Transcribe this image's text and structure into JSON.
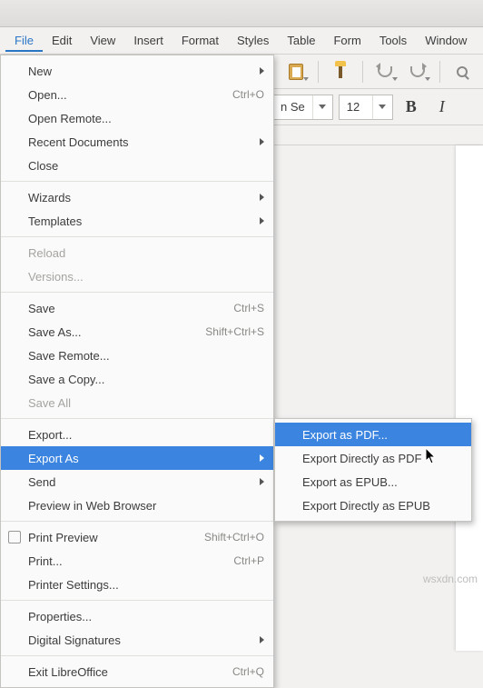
{
  "menu_bar": {
    "items": [
      "File",
      "Edit",
      "View",
      "Insert",
      "Format",
      "Styles",
      "Table",
      "Form",
      "Tools",
      "Window"
    ]
  },
  "format_bar": {
    "font_name_tail": "n Se",
    "font_size": "12",
    "bold": "B",
    "italic": "I"
  },
  "file_menu": [
    {
      "type": "item",
      "label": "New",
      "submenu": true
    },
    {
      "type": "item",
      "label": "Open...",
      "accel": "Ctrl+O"
    },
    {
      "type": "item",
      "label": "Open Remote..."
    },
    {
      "type": "item",
      "label": "Recent Documents",
      "submenu": true
    },
    {
      "type": "item",
      "label": "Close"
    },
    {
      "type": "divider"
    },
    {
      "type": "item",
      "label": "Wizards",
      "submenu": true
    },
    {
      "type": "item",
      "label": "Templates",
      "submenu": true
    },
    {
      "type": "divider"
    },
    {
      "type": "item",
      "label": "Reload",
      "disabled": true
    },
    {
      "type": "item",
      "label": "Versions...",
      "disabled": true
    },
    {
      "type": "divider"
    },
    {
      "type": "item",
      "label": "Save",
      "accel": "Ctrl+S"
    },
    {
      "type": "item",
      "label": "Save As...",
      "accel": "Shift+Ctrl+S"
    },
    {
      "type": "item",
      "label": "Save Remote..."
    },
    {
      "type": "item",
      "label": "Save a Copy..."
    },
    {
      "type": "item",
      "label": "Save All",
      "disabled": true
    },
    {
      "type": "divider"
    },
    {
      "type": "item",
      "label": "Export..."
    },
    {
      "type": "item",
      "label": "Export As",
      "submenu": true,
      "highlight": true
    },
    {
      "type": "item",
      "label": "Send",
      "submenu": true
    },
    {
      "type": "item",
      "label": "Preview in Web Browser"
    },
    {
      "type": "divider"
    },
    {
      "type": "item",
      "label": "Print Preview",
      "accel": "Shift+Ctrl+O",
      "checkbox": true
    },
    {
      "type": "item",
      "label": "Print...",
      "accel": "Ctrl+P"
    },
    {
      "type": "item",
      "label": "Printer Settings..."
    },
    {
      "type": "divider"
    },
    {
      "type": "item",
      "label": "Properties..."
    },
    {
      "type": "item",
      "label": "Digital Signatures",
      "submenu": true
    },
    {
      "type": "divider"
    },
    {
      "type": "item",
      "label": "Exit LibreOffice",
      "accel": "Ctrl+Q"
    }
  ],
  "export_submenu": [
    {
      "label": "Export as PDF...",
      "highlight": true
    },
    {
      "label": "Export Directly as PDF"
    },
    {
      "label": "Export as EPUB..."
    },
    {
      "label": "Export Directly as EPUB"
    }
  ],
  "watermark": "wsxdn.com"
}
